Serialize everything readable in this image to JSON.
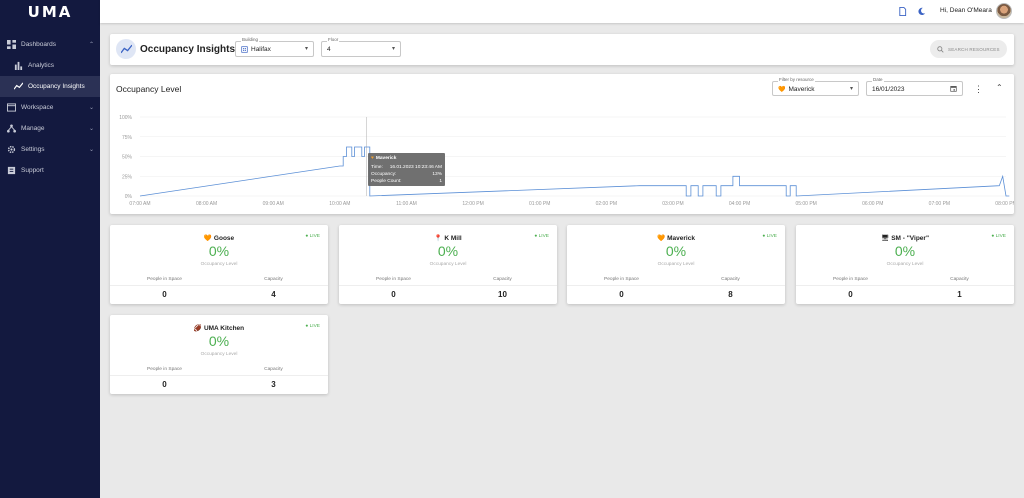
{
  "app": {
    "logo": "UMA"
  },
  "sidebar": {
    "items": [
      {
        "label": "Dashboards",
        "chevron": "⌃"
      },
      {
        "label": "Analytics"
      },
      {
        "label": "Occupancy Insights"
      },
      {
        "label": "Workspace",
        "chevron": "⌄"
      },
      {
        "label": "Manage",
        "chevron": "⌄"
      },
      {
        "label": "Settings",
        "chevron": "⌄"
      },
      {
        "label": "Support"
      }
    ]
  },
  "topbar": {
    "greeting": "Hi, Dean O'Meara"
  },
  "header": {
    "title": "Occupancy Insights",
    "building": {
      "label": "Building",
      "value": "Halifax"
    },
    "floor": {
      "label": "Floor",
      "value": "4"
    },
    "search_placeholder": "SEARCH RESOURCES"
  },
  "chart_card": {
    "title": "Occupancy Level",
    "filter": {
      "label": "Filter by resource",
      "value": "Maverick",
      "icon": "🧡"
    },
    "date": {
      "label": "Date",
      "value": "16/01/2023"
    },
    "tooltip": {
      "title": "Maverick",
      "rows": [
        {
          "k": "Time:",
          "v": "16.01.2023 10:23:46 AM"
        },
        {
          "k": "Occupancy:",
          "v": "13%"
        },
        {
          "k": "People Count:",
          "v": "1"
        }
      ]
    }
  },
  "chart_data": {
    "type": "line",
    "y_ticks": [
      "100%",
      "75%",
      "50%",
      "25%",
      "0%"
    ],
    "ylim": [
      0,
      100
    ],
    "x_ticks": [
      "07:00 AM",
      "08:00 AM",
      "09:00 AM",
      "10:00 AM",
      "11:00 AM",
      "12:00 PM",
      "01:00 PM",
      "02:00 PM",
      "03:00 PM",
      "04:00 PM",
      "05:00 PM",
      "06:00 PM",
      "07:00 PM",
      "08:00 PM"
    ],
    "series": [
      {
        "points": [
          [
            7.0,
            0
          ],
          [
            10.0,
            38
          ],
          [
            10.05,
            38
          ],
          [
            10.05,
            50
          ],
          [
            10.1,
            50
          ],
          [
            10.1,
            62
          ],
          [
            10.18,
            62
          ],
          [
            10.18,
            50
          ],
          [
            10.22,
            50
          ],
          [
            10.22,
            62
          ],
          [
            10.33,
            62
          ],
          [
            10.33,
            50
          ],
          [
            10.37,
            50
          ],
          [
            10.37,
            62
          ],
          [
            10.45,
            62
          ],
          [
            10.45,
            0
          ],
          [
            14.5,
            13
          ],
          [
            15.2,
            13
          ],
          [
            15.2,
            0
          ],
          [
            15.27,
            0
          ],
          [
            15.27,
            13
          ],
          [
            15.38,
            13
          ],
          [
            15.38,
            0
          ],
          [
            15.45,
            0
          ],
          [
            15.45,
            13
          ],
          [
            15.65,
            13
          ],
          [
            15.65,
            0
          ],
          [
            15.72,
            0
          ],
          [
            15.72,
            13
          ],
          [
            15.9,
            13
          ],
          [
            15.9,
            25
          ],
          [
            16.0,
            25
          ],
          [
            16.0,
            13
          ],
          [
            16.7,
            13
          ],
          [
            16.7,
            0
          ],
          [
            16.76,
            0
          ],
          [
            16.76,
            13
          ],
          [
            16.85,
            13
          ],
          [
            16.85,
            0
          ],
          [
            19.9,
            13
          ],
          [
            19.95,
            25
          ],
          [
            20.0,
            0
          ],
          [
            20.05,
            0
          ]
        ]
      }
    ],
    "cursor_x": 10.4
  },
  "cards": [
    {
      "icon": "🧡",
      "name": "Goose",
      "live": "● LIVE",
      "occupancy": "0%",
      "occ_label": "Occupancy Level",
      "people_label": "People in Space",
      "people": "0",
      "capacity_label": "Capacity",
      "capacity": "4"
    },
    {
      "icon": "📍",
      "name": "K Mill",
      "live": "● LIVE",
      "occupancy": "0%",
      "occ_label": "Occupancy Level",
      "people_label": "People in Space",
      "people": "0",
      "capacity_label": "Capacity",
      "capacity": "10"
    },
    {
      "icon": "🧡",
      "name": "Maverick",
      "live": "● LIVE",
      "occupancy": "0%",
      "occ_label": "Occupancy Level",
      "people_label": "People in Space",
      "people": "0",
      "capacity_label": "Capacity",
      "capacity": "8"
    },
    {
      "icon": "🖥",
      "name": "SM - \"Viper\"",
      "live": "● LIVE",
      "occupancy": "0%",
      "occ_label": "Occupancy Level",
      "people_label": "People in Space",
      "people": "0",
      "capacity_label": "Capacity",
      "capacity": "1"
    },
    {
      "icon": "🏈",
      "name": "UMA Kitchen",
      "live": "● LIVE",
      "occupancy": "0%",
      "occ_label": "Occupancy Level",
      "people_label": "People in Space",
      "people": "0",
      "capacity_label": "Capacity",
      "capacity": "3"
    }
  ],
  "colors": {
    "sidebar_bg": "#13193f",
    "accent_green": "#4caf50",
    "line": "#5b8fd6"
  }
}
